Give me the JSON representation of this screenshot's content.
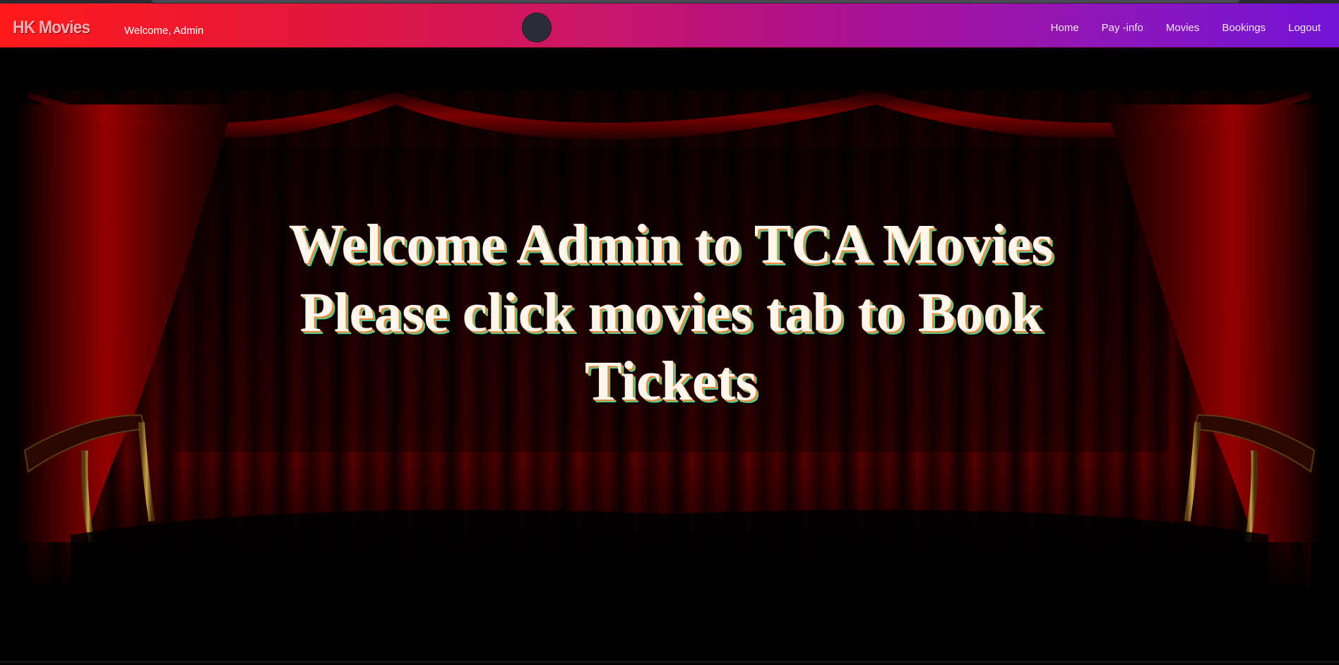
{
  "navbar": {
    "brand": "HK Movies",
    "welcome": "Welcome, Admin",
    "links": [
      {
        "label": "Home"
      },
      {
        "label": "Pay -info"
      },
      {
        "label": "Movies"
      },
      {
        "label": "Bookings"
      },
      {
        "label": "Logout"
      }
    ]
  },
  "hero": {
    "line1": "Welcome Admin to TCA Movies",
    "line2": "Please click movies tab to Book",
    "line3": "Tickets"
  },
  "colors": {
    "navbar_start": "#ff1a1a",
    "navbar_end": "#7314d6",
    "curtain": "#8a0000",
    "hero_text": "#fff6ee"
  }
}
